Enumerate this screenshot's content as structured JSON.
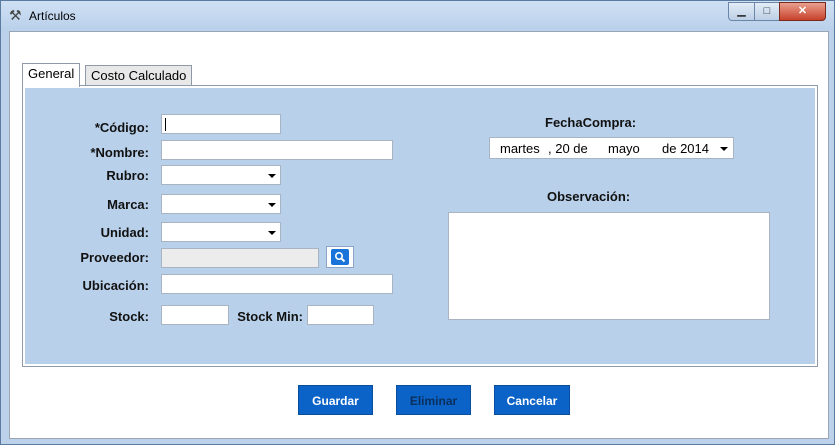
{
  "window": {
    "title": "Artículos"
  },
  "tabs": [
    {
      "label": "General"
    },
    {
      "label": "Costo Calculado"
    }
  ],
  "form": {
    "codigo_label": "*Código:",
    "nombre_label": "*Nombre:",
    "rubro_label": "Rubro:",
    "marca_label": "Marca:",
    "unidad_label": "Unidad:",
    "proveedor_label": "Proveedor:",
    "ubicacion_label": "Ubicación:",
    "stock_label": "Stock:",
    "stock_min_label": "Stock Min:",
    "fecha_label": "FechaCompra:",
    "fecha": {
      "weekday": "martes",
      "day": ", 20 de",
      "month": "mayo",
      "year": "de 2014"
    },
    "observacion_label": "Observación:"
  },
  "buttons": {
    "guardar": "Guardar",
    "eliminar": "Eliminar",
    "cancelar": "Cancelar"
  },
  "colors": {
    "panel_bg": "#b8d0ea",
    "button_blue": "#0b63c8"
  }
}
